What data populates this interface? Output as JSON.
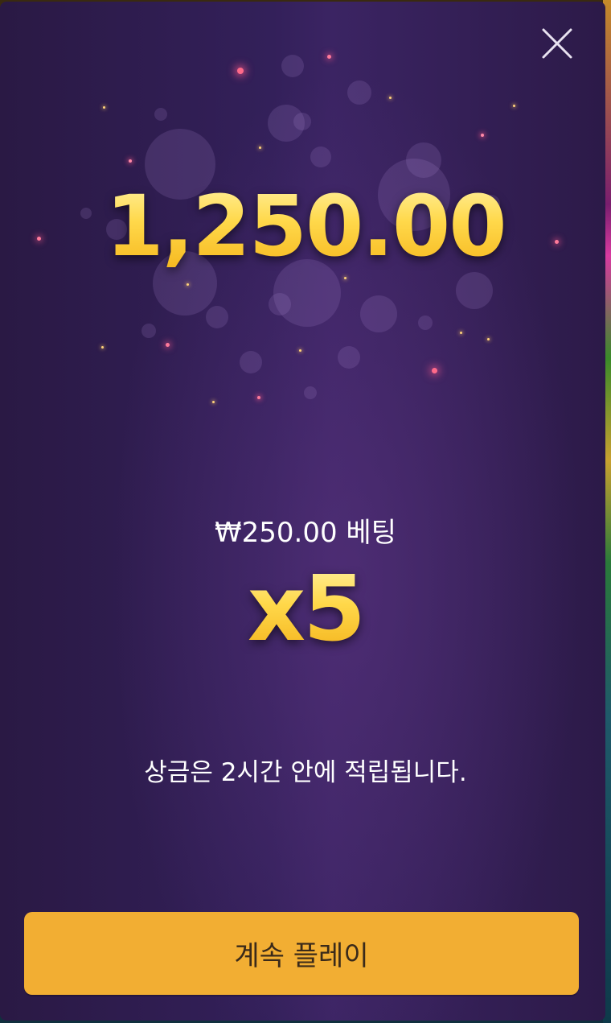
{
  "win": {
    "amount": "1,250.00"
  },
  "bet": {
    "label": "₩250.00 베팅"
  },
  "multiplier": {
    "label": "x5"
  },
  "notice": {
    "text": "상금은 2시간 안에 적립됩니다."
  },
  "actions": {
    "continue_label": "계속 플레이",
    "close_icon": "close-icon"
  },
  "colors": {
    "modal_bg": "#33205a",
    "gold": "#ffd54a",
    "button_bg": "#f2ae33",
    "button_text": "#3a2a1a"
  }
}
